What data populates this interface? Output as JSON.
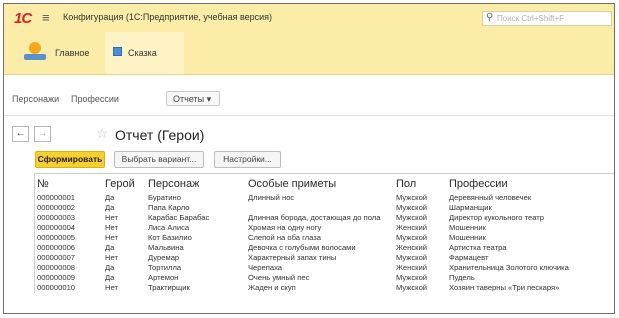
{
  "app": {
    "logo": "1С",
    "title": "Конфигурация (1С:Предприятие, учебная версия)",
    "search_placeholder": "Поиск Ctrl+Shift+F"
  },
  "sections": [
    {
      "label": "Главное"
    },
    {
      "label": "Сказка"
    }
  ],
  "subnav": {
    "links": [
      "Персонажи",
      "Профессии"
    ],
    "reports_label": "Отчеты ▾"
  },
  "report": {
    "title": "Отчет (Герои)",
    "buttons": {
      "generate": "Сформировать",
      "variant": "Выбрать вариант...",
      "settings": "Настройки..."
    },
    "columns": [
      "№",
      "Герой",
      "Персонаж",
      "Особые приметы",
      "Пол",
      "Профессии"
    ],
    "rows": [
      [
        "000000001",
        "Да",
        "Буратино",
        "Длинный нос",
        "Мужской",
        "Деревянный человечек"
      ],
      [
        "000000002",
        "Да",
        "Папа Карло",
        "",
        "Мужской",
        "Шарманщик"
      ],
      [
        "000000003",
        "Нет",
        "Карабас Барабас",
        "Длинная борода, достающая до пола",
        "Мужской",
        "Директор кукольного театр"
      ],
      [
        "000000004",
        "Нет",
        "Лиса Алиса",
        "Хромая на одну ногу",
        "Женский",
        "Мошенник"
      ],
      [
        "000000005",
        "Нет",
        "Кот Базилио",
        "Слепой на оба глаза",
        "Мужской",
        "Мошенник"
      ],
      [
        "000000006",
        "Да",
        "Мальвина",
        "Девочка с голубыми волосами",
        "Женский",
        "Артистка театра"
      ],
      [
        "000000007",
        "Нет",
        "Дуремар",
        "Характерный запах тины",
        "Мужской",
        "Фармацевт"
      ],
      [
        "000000008",
        "Да",
        "Тортилла",
        "Черепаха",
        "Женский",
        "Хранительница Золотого ключика"
      ],
      [
        "000000009",
        "Да",
        "Артемон",
        "Очень умный пес",
        "Мужской",
        "Пудель"
      ],
      [
        "000000010",
        "Нет",
        "Трактирщик",
        "Жаден и скуп",
        "Мужской",
        "Хозяин таверны «Три пескаря»"
      ]
    ]
  },
  "colors": {
    "topbar": "#fbeda7",
    "primary_button": "#f7d02d",
    "logo": "#d8232a"
  }
}
